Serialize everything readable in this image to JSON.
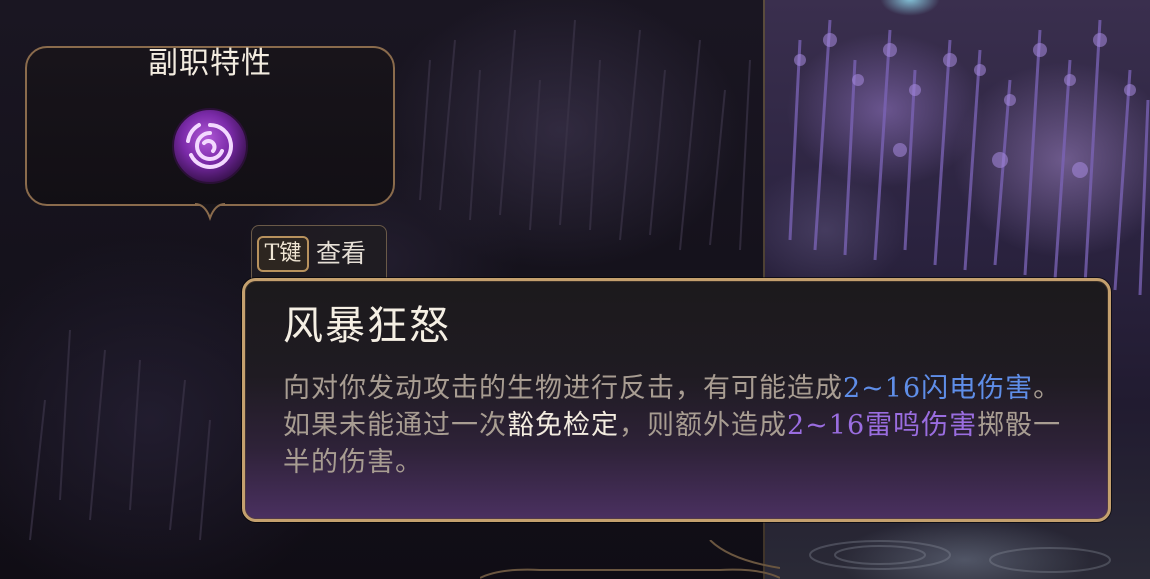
{
  "subclass": {
    "title": "副职特性",
    "emblem_icon": "storm-sorcery-icon"
  },
  "keyhint": {
    "key": "T键",
    "label": "查看"
  },
  "tooltip": {
    "title": "风暴狂怒",
    "desc_part1": "向对你发动攻击的生物进行反击，有可能造成",
    "dmg_lightning": "2~16闪电伤害",
    "desc_part2": "。如果未能通过一次",
    "save": "豁免检定",
    "desc_part3": "，则额外造成",
    "dmg_thunder": "2~16雷鸣伤害",
    "desc_part4": "掷骰一半的伤害。"
  },
  "colors": {
    "frame_gold": "#c4a06e",
    "lightning_blue": "#5f8ee8",
    "thunder_purple": "#9a6de0",
    "body_text": "#a89d92"
  }
}
